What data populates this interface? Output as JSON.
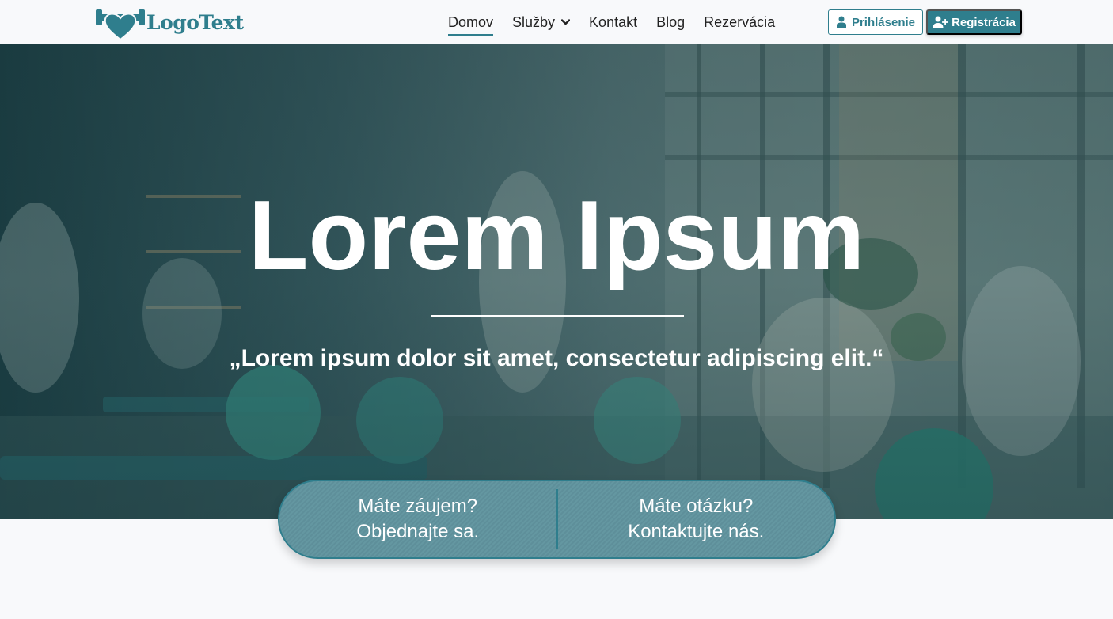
{
  "brand": {
    "logo_text": "LogoText",
    "accent_color": "#2f7e8d"
  },
  "nav": {
    "items": [
      {
        "label": "Domov",
        "active": true
      },
      {
        "label": "Služby",
        "has_dropdown": true
      },
      {
        "label": "Kontakt"
      },
      {
        "label": "Blog"
      },
      {
        "label": "Rezervácia"
      }
    ],
    "login_label": "Prihlásenie",
    "register_label": "Registrácia"
  },
  "hero": {
    "title": "Lorem Ipsum",
    "quote": "„Lorem ipsum dolor sit amet, consectetur adipiscing elit.“"
  },
  "cta": {
    "left": {
      "line1": "Máte záujem?",
      "line2": "Objednajte sa."
    },
    "right": {
      "line1": "Máte otázku?",
      "line2": "Kontaktujte nás."
    }
  }
}
